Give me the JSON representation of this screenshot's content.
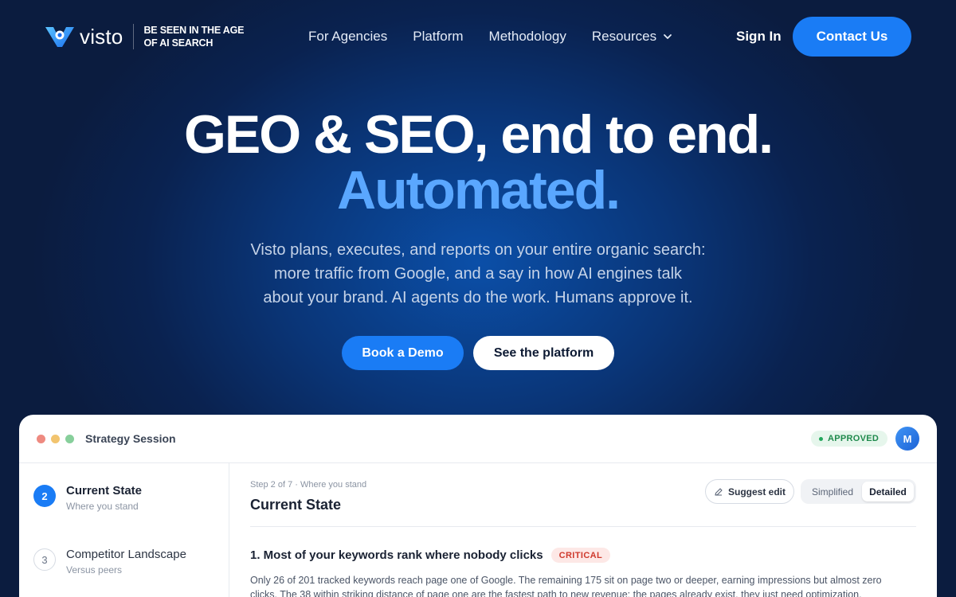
{
  "brand": {
    "name": "visto",
    "tagline": "BE SEEN IN THE AGE OF AI SEARCH",
    "accent": "#1a7cf5"
  },
  "nav": {
    "items": [
      {
        "label": "For Agencies"
      },
      {
        "label": "Platform"
      },
      {
        "label": "Methodology"
      },
      {
        "label": "Resources",
        "icon": "chevron-down-icon"
      }
    ],
    "signin": "Sign In",
    "contact": "Contact Us"
  },
  "hero": {
    "title_line1": "GEO & SEO, end to end.",
    "title_line2": "Automated.",
    "subtitle_lines": [
      "Visto plans, executes, and reports on your entire organic search:",
      "more traffic from Google, and a say in how AI engines talk",
      "about your brand. AI agents do the work. Humans approve it."
    ],
    "cta_primary": "Book a Demo",
    "cta_secondary": "See the platform"
  },
  "panel": {
    "title": "Strategy Session",
    "status": "APPROVED",
    "avatar_initial": "M",
    "steps": [
      {
        "num": "2",
        "name": "Current State",
        "desc": "Where you stand",
        "active": true
      },
      {
        "num": "3",
        "name": "Competitor Landscape",
        "desc": "Versus peers",
        "active": false
      }
    ],
    "breadcrumb": "Step 2 of 7 · Where you stand",
    "heading": "Current State",
    "suggest_edit": "Suggest edit",
    "view_toggle": {
      "simplified": "Simplified",
      "detailed": "Detailed",
      "selected": "Detailed"
    },
    "finding": {
      "title": "1. Most of your keywords rank where nobody clicks",
      "severity": "CRITICAL",
      "body": "Only 26 of 201 tracked keywords reach page one of Google. The remaining 175 sit on page two or deeper, earning impressions but almost zero clicks. The 38 within striking distance of page one are the fastest path to new revenue: the pages already exist, they just need optimization."
    }
  }
}
